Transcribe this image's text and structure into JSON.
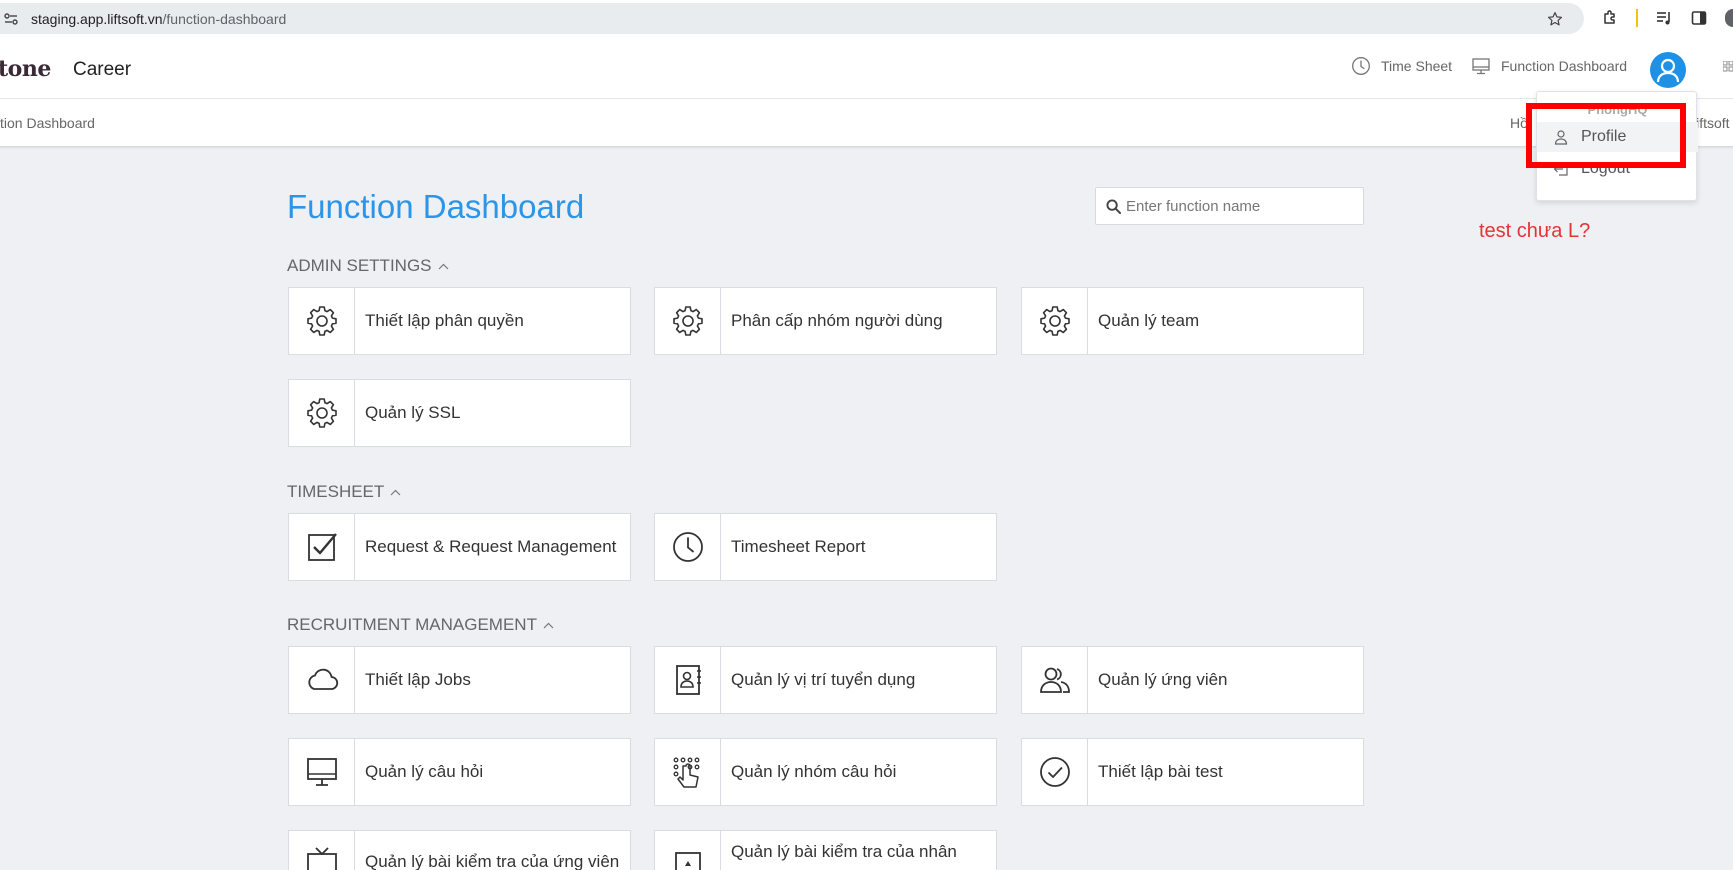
{
  "browser": {
    "url_host": "staging.app.liftsoft.vn",
    "url_path": "/function-dashboard"
  },
  "header": {
    "brand": "tone",
    "career": "Career",
    "nav": [
      {
        "label": "Time Sheet",
        "icon": "clock-icon"
      },
      {
        "label": "Function Dashboard",
        "icon": "monitor-icon"
      }
    ]
  },
  "breadcrumb": {
    "left": "tion Dashboard",
    "right_a": "Hồ",
    "right_b": "liftsoft"
  },
  "main": {
    "title": "Function Dashboard",
    "search_placeholder": "Enter function name",
    "sections": [
      {
        "title": "ADMIN SETTINGS",
        "items": [
          {
            "label": "Thiết lập phân quyền",
            "icon": "gear-icon"
          },
          {
            "label": "Phân cấp nhóm người dùng",
            "icon": "gear-icon"
          },
          {
            "label": "Quản lý team",
            "icon": "gear-icon"
          },
          {
            "label": "Quản lý SSL",
            "icon": "gear-icon"
          }
        ]
      },
      {
        "title": "TIMESHEET",
        "items": [
          {
            "label": "Request & Request Management",
            "icon": "checkbox-icon"
          },
          {
            "label": "Timesheet Report",
            "icon": "clock-icon"
          }
        ]
      },
      {
        "title": "RECRUITMENT MANAGEMENT",
        "items": [
          {
            "label": "Thiết lập Jobs",
            "icon": "cloud-icon"
          },
          {
            "label": "Quản lý vị trí tuyển dụng",
            "icon": "contact-book-icon"
          },
          {
            "label": "Quản lý ứng viên",
            "icon": "users-icon"
          },
          {
            "label": "Quản lý câu hỏi",
            "icon": "desktop-icon"
          },
          {
            "label": "Quản lý nhóm câu hỏi",
            "icon": "touch-grid-icon"
          },
          {
            "label": "Thiết lập bài test",
            "icon": "check-circle-icon"
          },
          {
            "label": "Quản lý bài kiểm tra của ứng viên",
            "icon": "tv-icon"
          },
          {
            "label": "Quản lý bài kiểm tra của nhân",
            "icon": "document-icon"
          }
        ]
      }
    ]
  },
  "user_menu": {
    "username": "PhongHQ",
    "items": [
      {
        "label": "Profile",
        "icon": "user-icon"
      },
      {
        "label": "Logout",
        "icon": "logout-icon"
      }
    ]
  },
  "annotation": {
    "note": "test chưa L?",
    "color": "#e53333"
  },
  "colors": {
    "accent": "#2b95e8",
    "avatar": "#1e90e6",
    "highlight_box": "#ff0000"
  }
}
